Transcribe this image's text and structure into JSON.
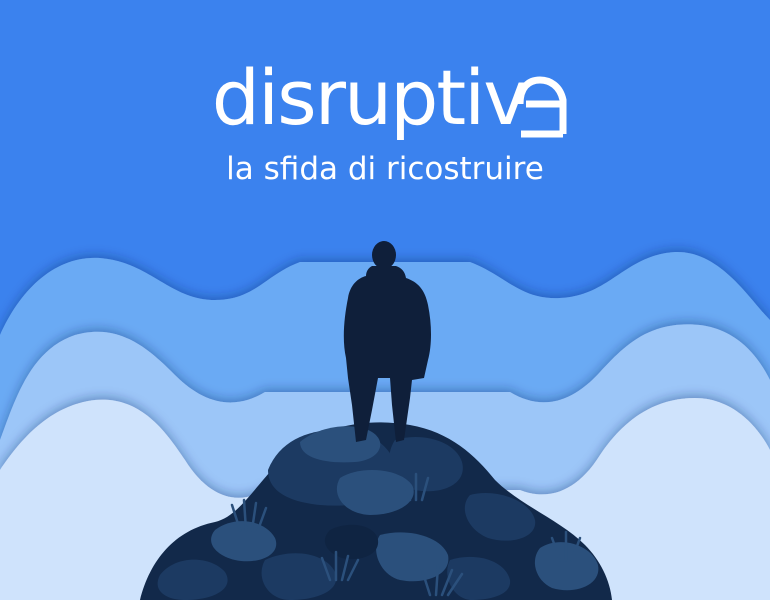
{
  "poster": {
    "title": "disruptiv",
    "title_logo_glyph": "e",
    "subtitle": "la sfida di ricostruire"
  },
  "colors": {
    "sky": "#3b82ee",
    "wave_1": "#6aaaf4",
    "wave_2": "#9cc6f8",
    "wave_3": "#cfe3fc",
    "silhouette": "#0f1f3a",
    "rocks_dark": "#12294a",
    "rocks_mid": "#1c3a62",
    "rocks_light": "#2b507c",
    "text": "#ffffff"
  },
  "icons": [
    "person-silhouette-icon",
    "rock-hill-icon",
    "grass-tuft-icon"
  ]
}
